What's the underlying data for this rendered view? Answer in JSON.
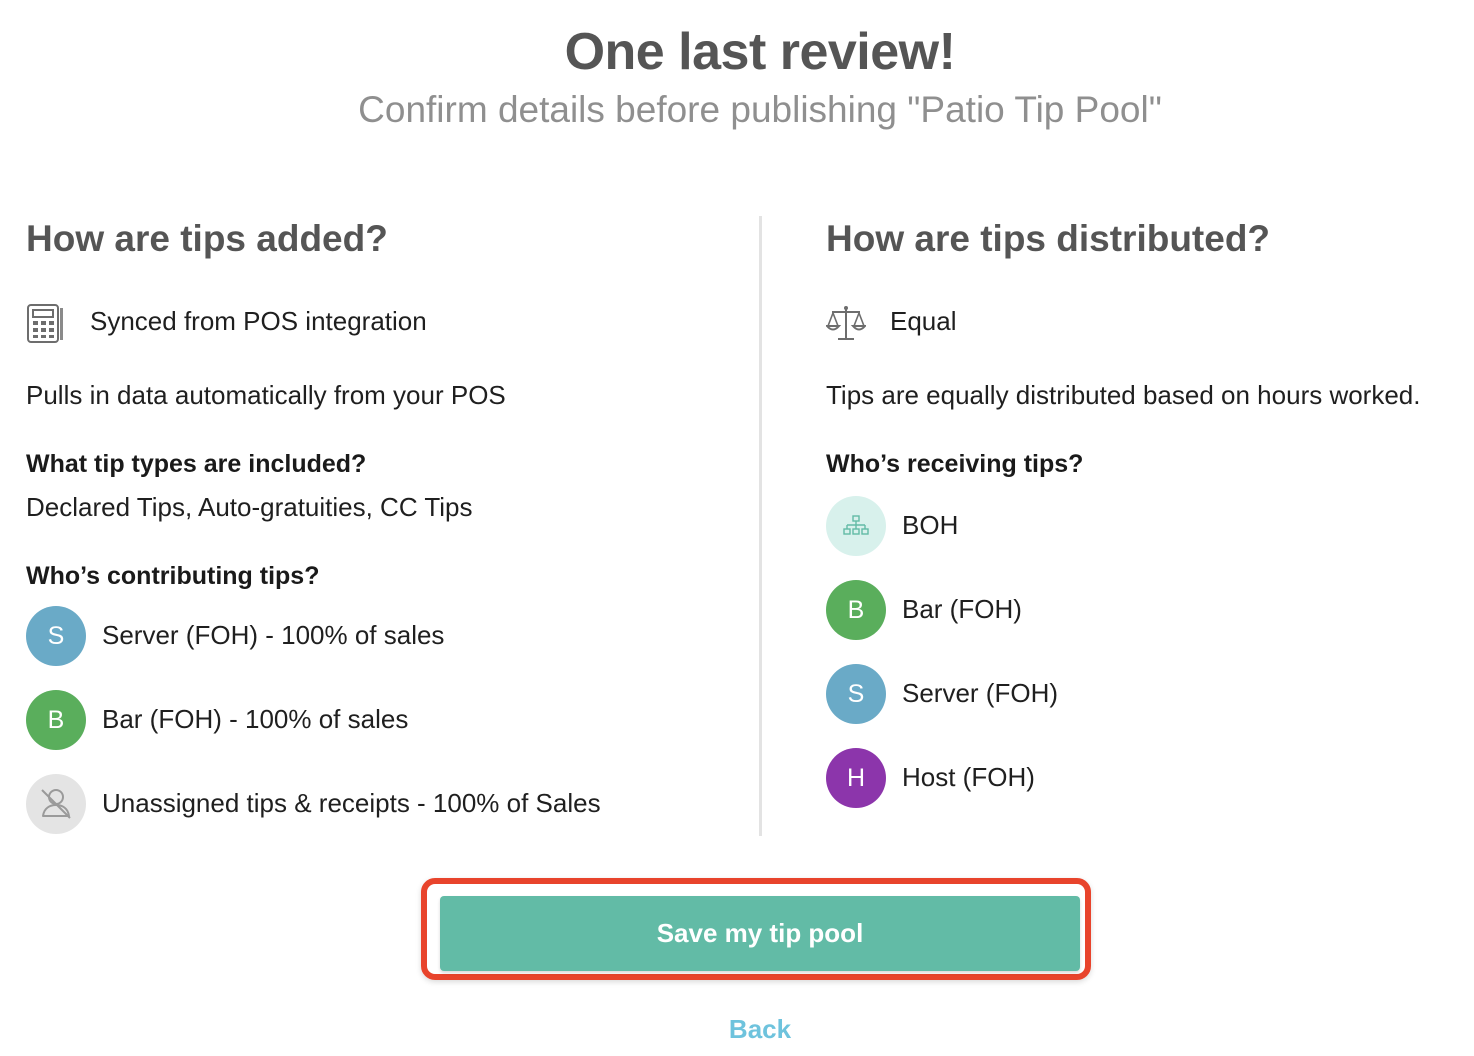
{
  "header": {
    "title": "One last review!",
    "subtitle": "Confirm details before publishing \"Patio Tip Pool\""
  },
  "left": {
    "heading": "How are tips added?",
    "method": {
      "icon": "pos-terminal-icon",
      "label": "Synced from POS integration"
    },
    "description": "Pulls in data automatically from your POS",
    "tip_types_heading": "What tip types are included?",
    "tip_types": "Declared Tips, Auto-gratuities, CC Tips",
    "contributors_heading": "Who’s contributing tips?",
    "contributors": [
      {
        "initial": "S",
        "label": "Server (FOH) - 100% of sales",
        "color": "#6aaac7"
      },
      {
        "initial": "B",
        "label": "Bar (FOH) - 100% of sales",
        "color": "#5aae5c"
      },
      {
        "icon": "unassigned-user-icon",
        "label": "Unassigned tips & receipts - 100% of Sales",
        "color": "#e4e4e4"
      }
    ]
  },
  "right": {
    "heading": "How are tips distributed?",
    "method": {
      "icon": "balance-scale-icon",
      "label": "Equal"
    },
    "description": "Tips are equally distributed based on hours worked.",
    "receivers_heading": "Who’s receiving tips?",
    "receivers": [
      {
        "icon": "org-chart-icon",
        "label": "BOH",
        "color": "#d8f1ec"
      },
      {
        "initial": "B",
        "label": "Bar (FOH)",
        "color": "#5aae5c"
      },
      {
        "initial": "S",
        "label": "Server (FOH)",
        "color": "#6aaac7"
      },
      {
        "initial": "H",
        "label": "Host (FOH)",
        "color": "#8c35ab"
      }
    ]
  },
  "actions": {
    "save_label": "Save my tip pool",
    "back_label": "Back"
  },
  "colors": {
    "accent": "#62bba6",
    "highlight": "#e8442c",
    "link": "#6ec3dd"
  }
}
